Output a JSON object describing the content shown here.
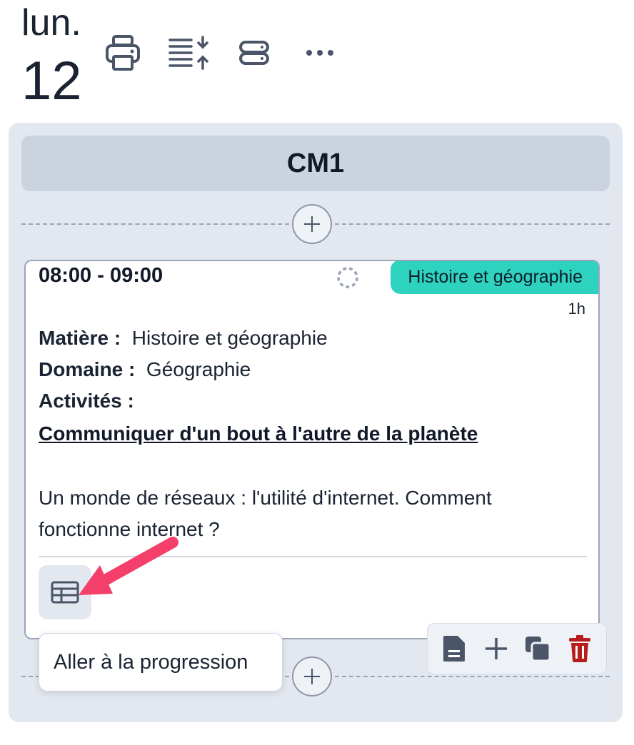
{
  "header": {
    "day_name": "lun.",
    "day_number": "12",
    "toolbar": [
      {
        "icon": "printer-icon"
      },
      {
        "icon": "sort-lines-icon"
      },
      {
        "icon": "stack-icon"
      },
      {
        "icon": "more-dots-icon"
      }
    ]
  },
  "column": {
    "class_name": "CM1",
    "lesson": {
      "time": "08:00 - 09:00",
      "subject_tag": "Histoire et géographie",
      "subject_color": "#2ed3bf",
      "duration": "1h",
      "fields": {
        "matiere_label": "Matière :",
        "matiere_value": "Histoire et géographie",
        "domaine_label": "Domaine :",
        "domaine_value": "Géographie",
        "activites_label": "Activités :"
      },
      "activity_link": "Communiquer d'un bout à l'autre de la planète",
      "description": "Un monde de réseaux : l'utilité d'internet. Comment fonctionne internet ?"
    },
    "actions": [
      {
        "icon": "document-icon"
      },
      {
        "icon": "plus-icon"
      },
      {
        "icon": "duplicate-icon"
      },
      {
        "icon": "trash-icon",
        "color": "#b91c1c"
      }
    ]
  },
  "tooltip": {
    "text": "Aller à la progression"
  },
  "annotation": {
    "arrow_color": "#f43f6b"
  }
}
